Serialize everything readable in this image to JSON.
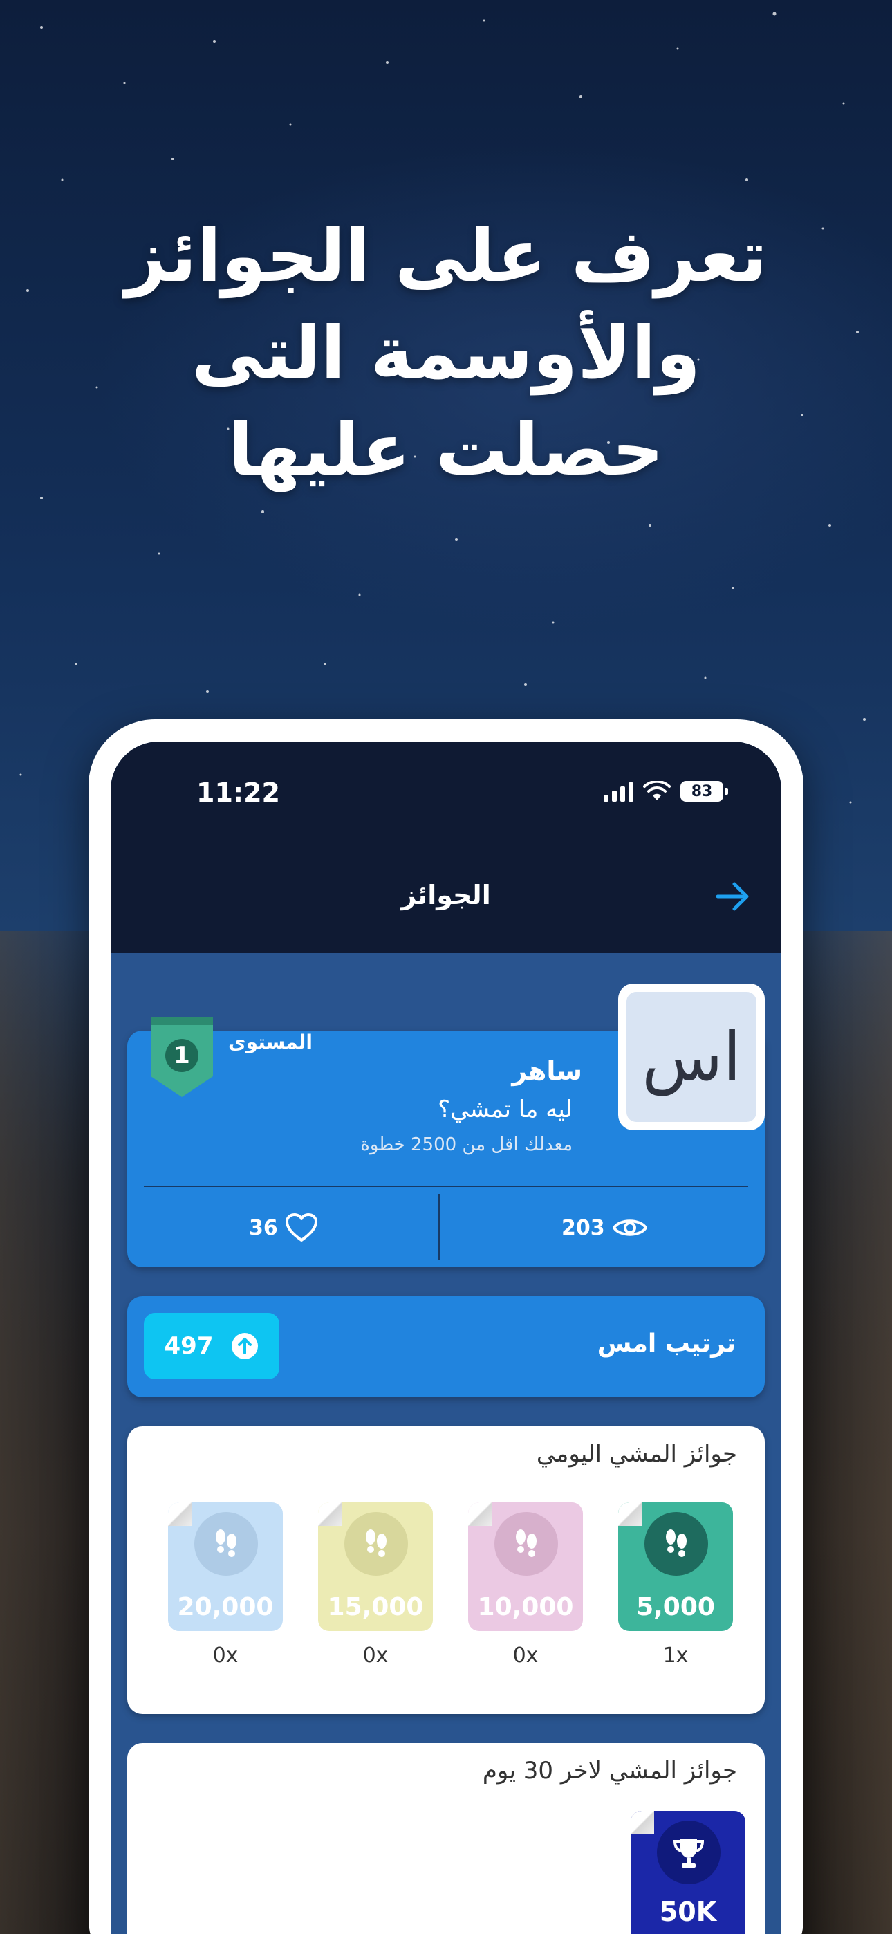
{
  "headline": {
    "line1": "تعرف على الجوائز",
    "line2": "والأوسمة التى",
    "line3": "حصلت عليها"
  },
  "status_bar": {
    "time": "11:22",
    "battery": "83"
  },
  "nav": {
    "title": "الجوائز",
    "back_icon": "arrow-right-icon"
  },
  "profile": {
    "avatar_initials": "اس",
    "level_label": "المستوى",
    "level": "1",
    "name": "ساهر",
    "status": "ليه ما تمشي؟",
    "subtitle": "معدلك اقل من 2500 خطوة",
    "likes": "36",
    "views": "203"
  },
  "rank": {
    "title": "ترتيب امس",
    "value": "497"
  },
  "daily_awards": {
    "title": "جوائز المشي اليومي",
    "items": [
      {
        "value": "5,000",
        "count": "1x",
        "tile_color": "#3db59b",
        "circle_color": "#1e6b5e",
        "earned": true
      },
      {
        "value": "10,000",
        "count": "0x",
        "tile_color": "#ebc9e3",
        "circle_color": "#d7b0cc",
        "earned": false
      },
      {
        "value": "15,000",
        "count": "0x",
        "tile_color": "#ecebb4",
        "circle_color": "#d8d79c",
        "earned": false
      },
      {
        "value": "20,000",
        "count": "0x",
        "tile_color": "#c4dff7",
        "circle_color": "#aecbe6",
        "earned": false
      }
    ]
  },
  "monthly_awards": {
    "title": "جوائز المشي لاخر 30 يوم",
    "items": [
      {
        "value": "50K",
        "icon": "trophy-icon",
        "tile_color": "#1b27a8"
      }
    ]
  }
}
